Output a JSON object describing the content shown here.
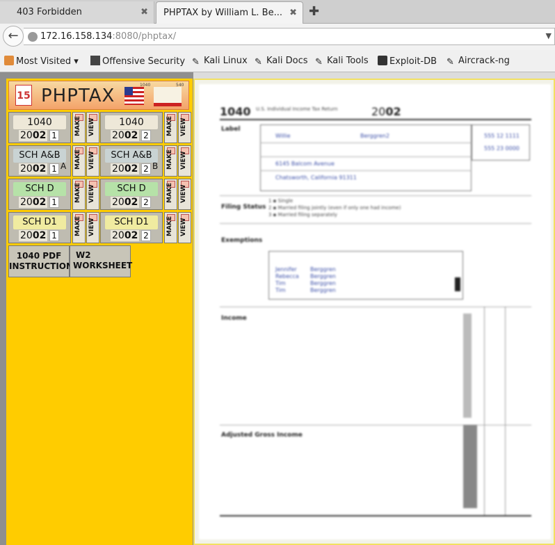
{
  "tabs": [
    {
      "title": "403 Forbidden",
      "active": false
    },
    {
      "title": "PHPTAX by William L. Be...",
      "active": true
    }
  ],
  "url": {
    "host": "172.16.158.134",
    "rest": ":8080/phptax/"
  },
  "bookmarks": [
    {
      "label": "Most Visited",
      "icon": "folder-icon"
    },
    {
      "label": "Offensive Security",
      "icon": "offsec-icon"
    },
    {
      "label": "Kali Linux",
      "icon": "kali-dragon-icon"
    },
    {
      "label": "Kali Docs",
      "icon": "kali-dragon-icon"
    },
    {
      "label": "Kali Tools",
      "icon": "kali-dragon-icon"
    },
    {
      "label": "Exploit-DB",
      "icon": "exploitdb-icon"
    },
    {
      "label": "Aircrack-ng",
      "icon": "aircrack-icon"
    }
  ],
  "header": {
    "title": "PHPTAX",
    "cal": "15",
    "cal_top": "APRIL",
    "flag_num_us": "1040",
    "flag_num_ca": "540"
  },
  "forms": [
    {
      "label": "1040",
      "small": "Form",
      "year_a": "20",
      "year_b": "02",
      "num": "1",
      "side": ""
    },
    {
      "label": "1040",
      "small": "Form",
      "year_a": "20",
      "year_b": "02",
      "num": "2",
      "side": ""
    },
    {
      "label": "SCH A&B",
      "small": "",
      "year_a": "20",
      "year_b": "02",
      "num": "1",
      "side": "A"
    },
    {
      "label": "SCH A&B",
      "small": "",
      "year_a": "20",
      "year_b": "02",
      "num": "2",
      "side": "B"
    },
    {
      "label": "SCH D",
      "small": "",
      "year_a": "20",
      "year_b": "02",
      "num": "1",
      "side": ""
    },
    {
      "label": "SCH D",
      "small": "",
      "year_a": "20",
      "year_b": "02",
      "num": "2",
      "side": ""
    },
    {
      "label": "SCH D1",
      "small": "",
      "year_a": "20",
      "year_b": "02",
      "num": "1",
      "side": ""
    },
    {
      "label": "SCH D1",
      "small": "",
      "year_a": "20",
      "year_b": "02",
      "num": "2",
      "side": ""
    }
  ],
  "buttons": {
    "make": "MAKE",
    "view": "VIEW"
  },
  "bottom": {
    "pdf_a": "1040 PDF",
    "pdf_b": "INSTRUCTIONS",
    "w2_a": "W2",
    "w2_b": "WORKSHEET"
  },
  "doc": {
    "form": "1040",
    "year_a": "20",
    "year_b": "02",
    "header": "U.S. Individual Income Tax Return",
    "first_name": "Willie",
    "last_name": "Berggren2",
    "ssn1": "555 12 1111",
    "ssn2": "555 23 0000",
    "address": "6145 Balcom Avenue",
    "city": "Chatsworth, California 91311",
    "section_label": "Label",
    "section_filing": "Filing Status",
    "section_exemptions": "Exemptions",
    "section_income": "Income",
    "section_adjusted": "Adjusted Gross Income",
    "deps": [
      {
        "name": "Jennifer",
        "last": "Berggren"
      },
      {
        "name": "Rebecca",
        "last": "Berggren"
      },
      {
        "name": "Tim",
        "last": "Berggren"
      },
      {
        "name": "Tim",
        "last": "Berggren"
      }
    ]
  }
}
